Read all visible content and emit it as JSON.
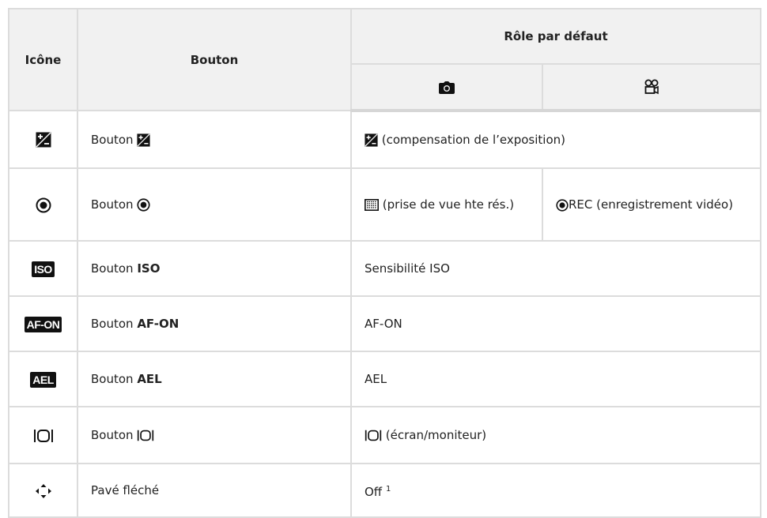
{
  "header": {
    "icon_col": "Icône",
    "button_col": "Bouton",
    "role_col": "Rôle par défaut",
    "photo_icon": "camera-icon",
    "video_icon": "movie-camera-icon"
  },
  "rows": [
    {
      "icon": "exposure-compensation-icon",
      "button_prefix": "Bouton",
      "role_suffix": "(compensation de l’exposition)"
    },
    {
      "icon": "record-icon",
      "button_prefix": "Bouton",
      "role_photo": "(prise de vue hte rés.)",
      "role_video": "REC (enregistrement vidéo)"
    },
    {
      "icon": "ISO",
      "button_prefix": "Bouton",
      "button_bold": "ISO",
      "role": "Sensibilité ISO"
    },
    {
      "icon": "AF-ON",
      "button_prefix": "Bouton",
      "button_bold": "AF-ON",
      "role": "AF-ON"
    },
    {
      "icon": "AEL",
      "button_prefix": "Bouton",
      "button_bold": "AEL",
      "role": "AEL"
    },
    {
      "icon": "monitor-switch-icon",
      "button_prefix": "Bouton",
      "role_suffix": "(écran/moniteur)"
    },
    {
      "icon": "arrow-pad-icon",
      "button_label": "Pavé fléché",
      "role": "Off",
      "role_footnote": "1"
    }
  ]
}
